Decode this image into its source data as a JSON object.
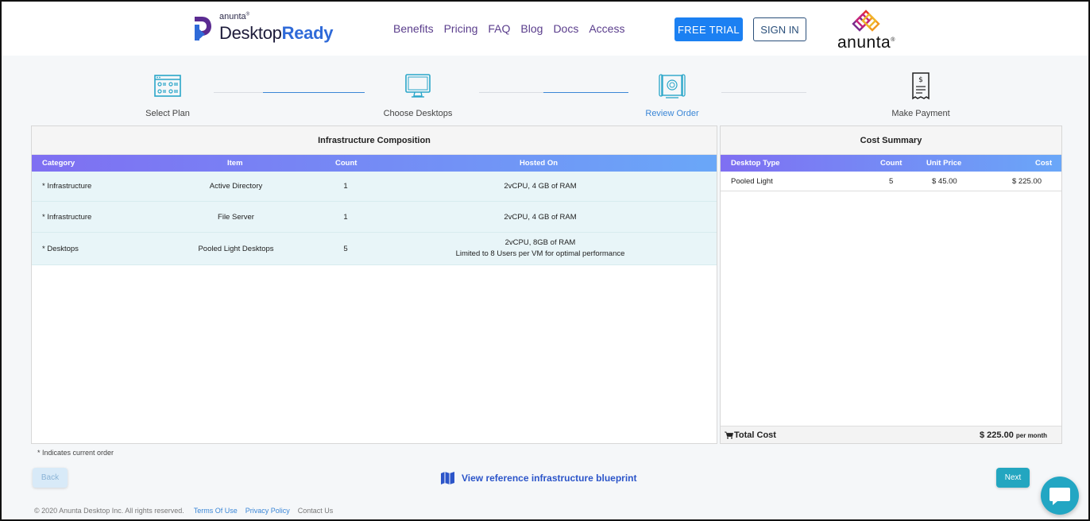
{
  "brand": {
    "small": "anunta",
    "reg": "®",
    "big_a": "Desktop",
    "big_b": "Ready"
  },
  "nav": [
    "Benefits",
    "Pricing",
    "FAQ",
    "Blog",
    "Docs",
    "Access"
  ],
  "buttons": {
    "free_trial": "FREE TRIAL",
    "sign_in": "SIGN IN",
    "back": "Back",
    "next": "Next"
  },
  "partner_logo": {
    "text": "anunta",
    "reg": "®"
  },
  "steps": [
    {
      "label": "Select Plan",
      "icon": "browser-grid-icon",
      "active": false
    },
    {
      "label": "Choose Desktops",
      "icon": "monitor-icon",
      "active": false
    },
    {
      "label": "Review Order",
      "icon": "blueprint-icon",
      "active": true
    },
    {
      "label": "Make Payment",
      "icon": "receipt-icon",
      "active": false
    }
  ],
  "infra": {
    "title": "Infrastructure Composition",
    "headers": [
      "Category",
      "Item",
      "Count",
      "Hosted On"
    ],
    "rows": [
      {
        "category": "* Infrastructure",
        "item": "Active Directory",
        "count": "1",
        "hosted": "2vCPU, 4 GB of RAM",
        "hosted2": ""
      },
      {
        "category": "* Infrastructure",
        "item": "File Server",
        "count": "1",
        "hosted": "2vCPU, 4 GB of RAM",
        "hosted2": ""
      },
      {
        "category": "* Desktops",
        "item": "Pooled Light Desktops",
        "count": "5",
        "hosted": "2vCPU, 8GB of RAM",
        "hosted2": "Limited to 8 Users per VM for optimal performance"
      }
    ]
  },
  "cost": {
    "title": "Cost Summary",
    "headers": [
      "Desktop Type",
      "Count",
      "Unit Price",
      "Cost"
    ],
    "rows": [
      {
        "type": "Pooled Light",
        "count": "5",
        "unit": "$ 45.00",
        "cost": "$ 225.00"
      }
    ],
    "total_label": "Total Cost",
    "total_value": "$ 225.00",
    "total_period": "per month"
  },
  "note": "* Indicates current order",
  "blueprint_link": "View reference infrastructure blueprint",
  "footer": {
    "copyright": "© 2020 Anunta Desktop Inc. All rights reserved.",
    "terms": "Terms Of Use",
    "privacy": "Privacy Policy",
    "contact": "Contact Us"
  },
  "colors": {
    "primary": "#1b80f2",
    "accent": "#3a86d6",
    "teal": "#23a6c0",
    "nav": "#5a3d8c"
  }
}
